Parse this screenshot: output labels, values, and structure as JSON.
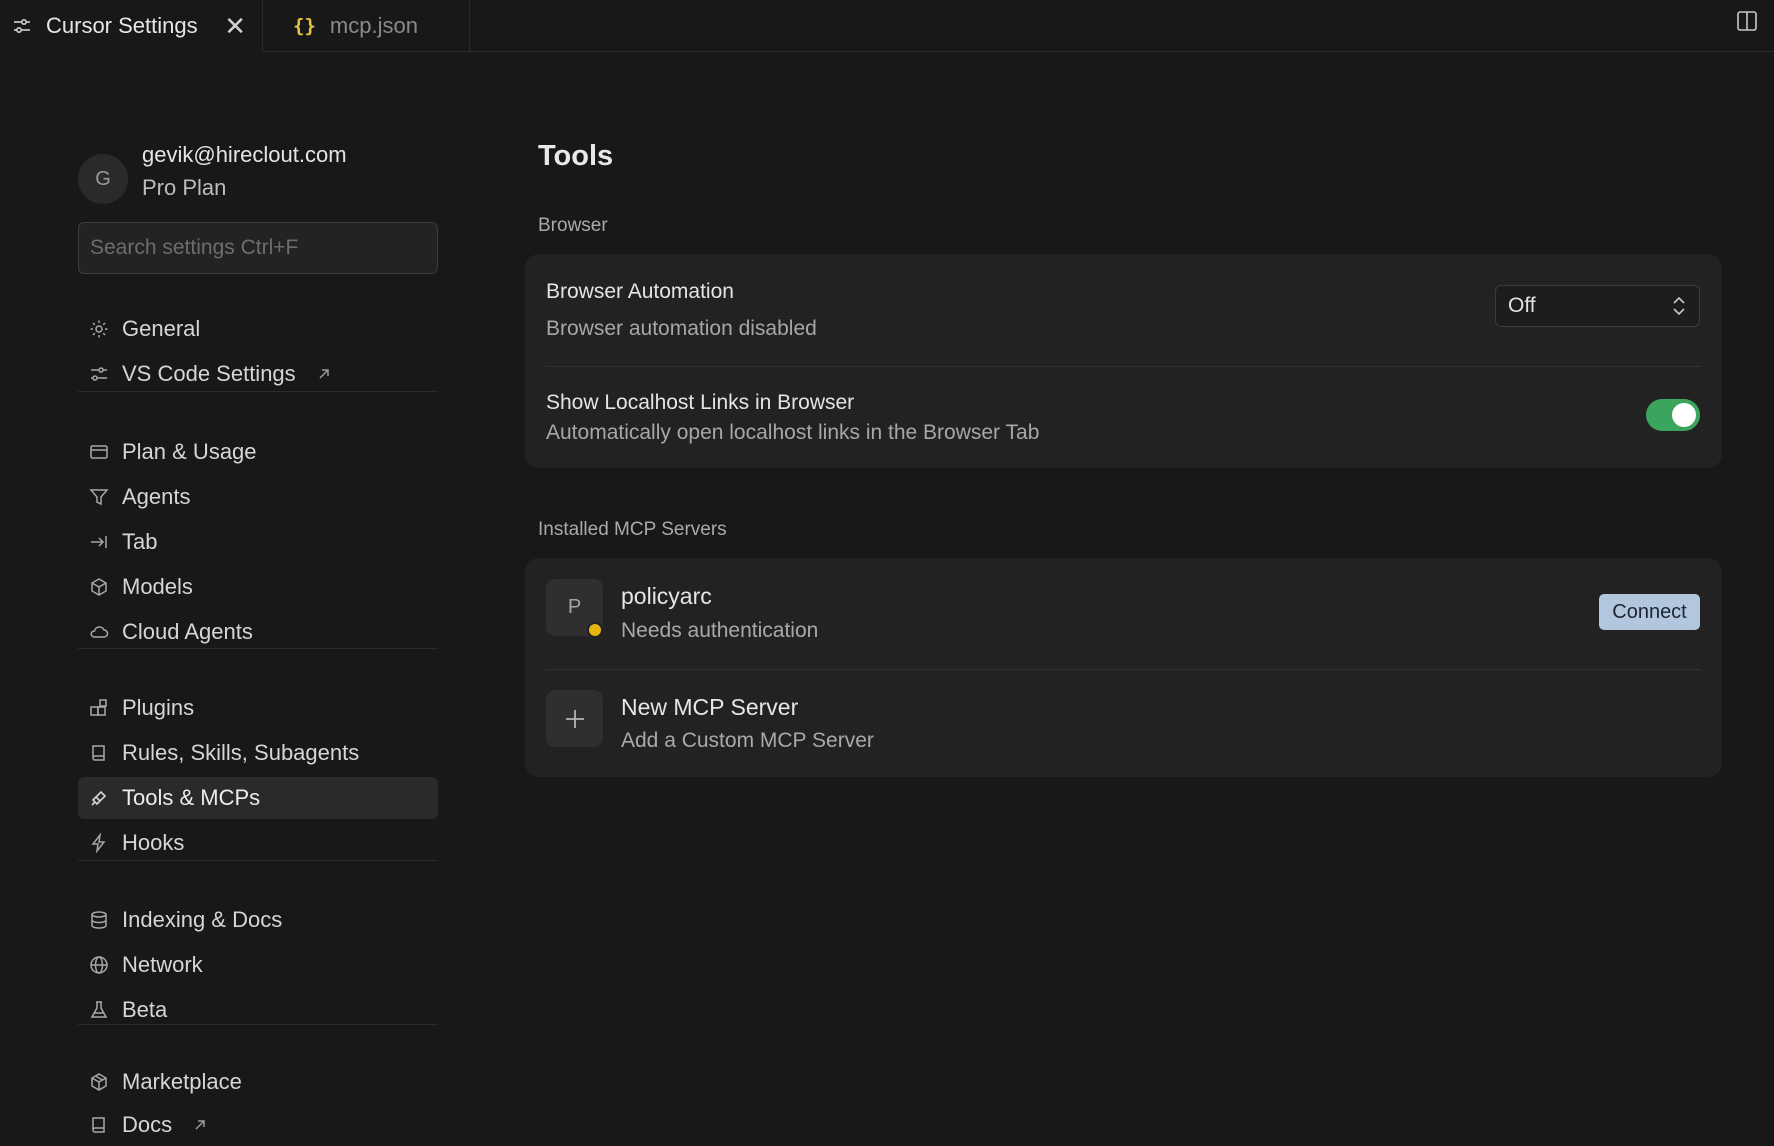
{
  "tabs": [
    {
      "label": "Cursor Settings",
      "icon": "sliders-icon",
      "active": true,
      "close": "✕"
    },
    {
      "label": "mcp.json",
      "icon": "{}",
      "active": false
    }
  ],
  "account": {
    "initial": "G",
    "email": "gevik@hireclout.com",
    "plan": "Pro Plan"
  },
  "search": {
    "placeholder": "Search settings Ctrl+F"
  },
  "sidebar": {
    "groups": [
      [
        {
          "label": "General",
          "icon": "gear-icon"
        },
        {
          "label": "VS Code Settings",
          "icon": "sliders-icon",
          "external": true
        }
      ],
      [
        {
          "label": "Plan & Usage",
          "icon": "credit-card-icon"
        },
        {
          "label": "Agents",
          "icon": "funnel-icon"
        },
        {
          "label": "Tab",
          "icon": "arrow-to-right-icon"
        },
        {
          "label": "Models",
          "icon": "cube-icon"
        },
        {
          "label": "Cloud Agents",
          "icon": "cloud-icon"
        }
      ],
      [
        {
          "label": "Plugins",
          "icon": "blocks-icon"
        },
        {
          "label": "Rules, Skills, Subagents",
          "icon": "book-icon"
        },
        {
          "label": "Tools & MCPs",
          "icon": "tools-icon",
          "selected": true
        },
        {
          "label": "Hooks",
          "icon": "lightning-icon"
        }
      ],
      [
        {
          "label": "Indexing & Docs",
          "icon": "database-icon"
        },
        {
          "label": "Network",
          "icon": "globe-icon"
        },
        {
          "label": "Beta",
          "icon": "flask-icon"
        }
      ],
      [
        {
          "label": "Marketplace",
          "icon": "package-icon"
        },
        {
          "label": "Docs",
          "icon": "book-icon",
          "external": true
        }
      ]
    ]
  },
  "main": {
    "title": "Tools",
    "browser_section": {
      "label": "Browser",
      "automation": {
        "title": "Browser Automation",
        "subtitle": "Browser automation disabled",
        "value": "Off"
      },
      "localhost": {
        "title": "Show Localhost Links in Browser",
        "subtitle": "Automatically open localhost links in the Browser Tab",
        "enabled": true
      }
    },
    "mcp_section": {
      "label": "Installed MCP Servers",
      "servers": [
        {
          "initial": "P",
          "name": "policyarc",
          "status": "Needs authentication",
          "action": "Connect",
          "status_color": "#e6b713"
        }
      ],
      "new_server": {
        "title": "New MCP Server",
        "subtitle": "Add a Custom MCP Server"
      }
    }
  },
  "colors": {
    "background": "#181818",
    "card": "#222222",
    "toggle_on": "#3ba55d",
    "connect_button": "#b2c6dd",
    "tab_braces": "#e1c244"
  }
}
